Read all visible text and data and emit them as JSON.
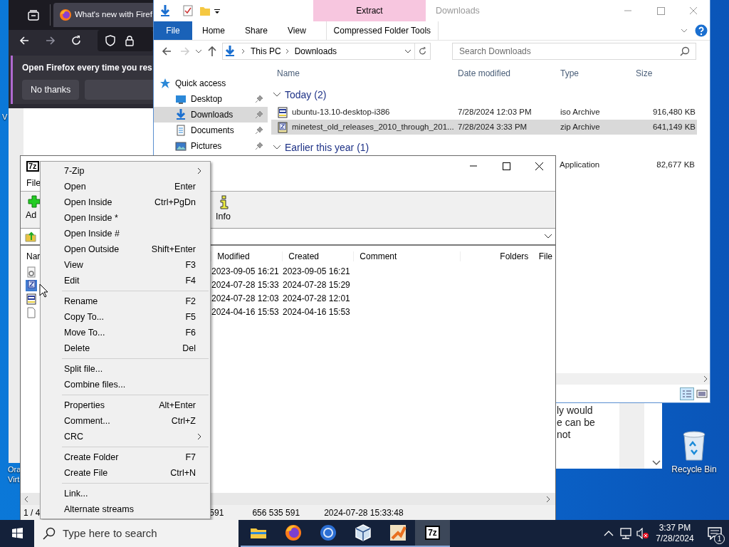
{
  "desktop": {
    "icons": [
      {
        "label": "Recycle Bin"
      }
    ],
    "partial_labels": [
      "V",
      "Ora",
      "Virt"
    ]
  },
  "firefox": {
    "tab_title": "What's new with Firef",
    "notification": {
      "message": "Open Firefox every time you res",
      "button": "No thanks"
    },
    "page_text": [
      "ly would",
      "e can be",
      "not"
    ]
  },
  "explorer": {
    "title": "Downloads",
    "contextual_group": "Extract",
    "ribbon_tabs": [
      {
        "label": "File",
        "kind": "file"
      },
      {
        "label": "Home",
        "kind": "tab"
      },
      {
        "label": "Share",
        "kind": "tab"
      },
      {
        "label": "View",
        "kind": "tab"
      },
      {
        "label": "Compressed Folder Tools",
        "kind": "contextual"
      }
    ],
    "address": [
      "This PC",
      "Downloads"
    ],
    "search": {
      "placeholder": "Search Downloads"
    },
    "nav": [
      {
        "label": "Quick access",
        "kind": "star",
        "selected": false,
        "pinned": false
      },
      {
        "label": "Desktop",
        "kind": "desktop",
        "selected": false,
        "pinned": true
      },
      {
        "label": "Downloads",
        "kind": "download",
        "selected": true,
        "pinned": true
      },
      {
        "label": "Documents",
        "kind": "document",
        "selected": false,
        "pinned": true
      },
      {
        "label": "Pictures",
        "kind": "pictures",
        "selected": false,
        "pinned": true
      }
    ],
    "columns": [
      "Name",
      "Date modified",
      "Type",
      "Size"
    ],
    "groups": [
      {
        "label": "Today (2)",
        "expanded": true,
        "rows": [
          {
            "kind": "iso",
            "name": "ubuntu-13.10-desktop-i386",
            "date": "7/28/2024 12:03 PM",
            "type": "iso Archive",
            "size": "916,480 KB",
            "selected": false
          },
          {
            "kind": "zip",
            "name": "minetest_old_releases_2010_through_201...",
            "date": "7/28/2024 3:33 PM",
            "type": "zip Archive",
            "size": "641,149 KB",
            "selected": true
          }
        ]
      },
      {
        "label": "Earlier this year (1)",
        "expanded": true,
        "rows": [
          {
            "type": "Application",
            "size": "82,677 KB",
            "selected": false
          }
        ]
      }
    ]
  },
  "sevenzip": {
    "icon_label": "7z",
    "menu": [
      "File"
    ],
    "toolbar": [
      {
        "label": "Ad",
        "kind": "add"
      },
      {
        "label": "Info",
        "kind": "info"
      }
    ],
    "columns": [
      "Nar",
      "Modified",
      "Created",
      "Comment",
      "Folders",
      "File"
    ],
    "rows": [
      {
        "kind": "exe",
        "modified": "2023-09-05 16:21",
        "created": "2023-09-05 16:21",
        "selected": false
      },
      {
        "kind": "zip",
        "modified": "2024-07-28 15:33",
        "created": "2024-07-28 15:29",
        "selected": true
      },
      {
        "kind": "iso",
        "modified": "2024-07-28 12:03",
        "created": "2024-07-28 12:01",
        "selected": false
      },
      {
        "kind": "file",
        "modified": "2024-04-16 15:53",
        "created": "2024-04-16 15:53",
        "selected": false
      }
    ],
    "status": [
      "1 / 4",
      "591",
      "656 535 591",
      "2024-07-28 15:33:48"
    ]
  },
  "context_menu": [
    {
      "kind": "item",
      "label": "7-Zip",
      "submenu": true
    },
    {
      "kind": "item",
      "label": "Open",
      "shortcut": "Enter"
    },
    {
      "kind": "item",
      "label": "Open Inside",
      "shortcut": "Ctrl+PgDn"
    },
    {
      "kind": "item",
      "label": "Open Inside *"
    },
    {
      "kind": "item",
      "label": "Open Inside #"
    },
    {
      "kind": "item",
      "label": "Open Outside",
      "shortcut": "Shift+Enter"
    },
    {
      "kind": "item",
      "label": "View",
      "shortcut": "F3"
    },
    {
      "kind": "item",
      "label": "Edit",
      "shortcut": "F4"
    },
    {
      "kind": "separator"
    },
    {
      "kind": "item",
      "label": "Rename",
      "shortcut": "F2"
    },
    {
      "kind": "item",
      "label": "Copy To...",
      "shortcut": "F5"
    },
    {
      "kind": "item",
      "label": "Move To...",
      "shortcut": "F6"
    },
    {
      "kind": "item",
      "label": "Delete",
      "shortcut": "Del"
    },
    {
      "kind": "separator"
    },
    {
      "kind": "item",
      "label": "Split file..."
    },
    {
      "kind": "item",
      "label": "Combine files..."
    },
    {
      "kind": "separator"
    },
    {
      "kind": "item",
      "label": "Properties",
      "shortcut": "Alt+Enter"
    },
    {
      "kind": "item",
      "label": "Comment...",
      "shortcut": "Ctrl+Z"
    },
    {
      "kind": "item",
      "label": "CRC",
      "submenu": true
    },
    {
      "kind": "separator"
    },
    {
      "kind": "item",
      "label": "Create Folder",
      "shortcut": "F7"
    },
    {
      "kind": "item",
      "label": "Create File",
      "shortcut": "Ctrl+N"
    },
    {
      "kind": "separator"
    },
    {
      "kind": "item",
      "label": "Link..."
    },
    {
      "kind": "item",
      "label": "Alternate streams"
    }
  ],
  "taskbar": {
    "search": {
      "placeholder": "Type here to search"
    },
    "apps": [
      {
        "kind": "explorer",
        "active": false
      },
      {
        "kind": "firefox",
        "active": false
      },
      {
        "kind": "ring",
        "active": false
      },
      {
        "kind": "cube",
        "active": false
      },
      {
        "kind": "brush",
        "active": false
      },
      {
        "kind": "sevenzip",
        "label": "7z",
        "active": true
      }
    ],
    "time": "3:37 PM",
    "date": "7/28/2024",
    "notifications": "1"
  }
}
